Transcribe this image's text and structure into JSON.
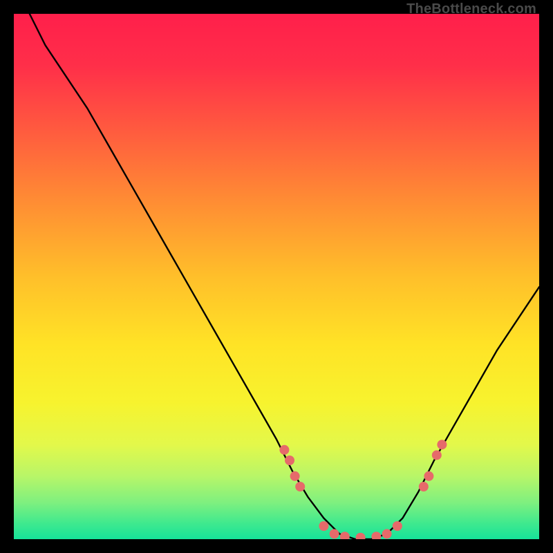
{
  "watermark": "TheBottleneck.com",
  "chart_data": {
    "type": "line",
    "title": "",
    "xlabel": "",
    "ylabel": "",
    "xlim": [
      0,
      100
    ],
    "ylim": [
      0,
      100
    ],
    "series": [
      {
        "name": "bottleneck-curve",
        "x": [
          3,
          6,
          10,
          14,
          18,
          22,
          26,
          30,
          34,
          38,
          42,
          46,
          50,
          53,
          56,
          59,
          62,
          65,
          68,
          71,
          74,
          77,
          80,
          84,
          88,
          92,
          96,
          100
        ],
        "y": [
          100,
          94,
          88,
          82,
          75,
          68,
          61,
          54,
          47,
          40,
          33,
          26,
          19,
          13,
          8,
          4,
          1,
          0,
          0,
          1,
          4,
          9,
          15,
          22,
          29,
          36,
          42,
          48
        ]
      }
    ],
    "scatter": {
      "name": "highlight-dots",
      "color": "#e66a6a",
      "points": [
        {
          "x": 51.5,
          "y": 17
        },
        {
          "x": 52.5,
          "y": 15
        },
        {
          "x": 53.5,
          "y": 12
        },
        {
          "x": 54.5,
          "y": 10
        },
        {
          "x": 59,
          "y": 2.5
        },
        {
          "x": 61,
          "y": 1
        },
        {
          "x": 63,
          "y": 0.5
        },
        {
          "x": 66,
          "y": 0.3
        },
        {
          "x": 69,
          "y": 0.5
        },
        {
          "x": 71,
          "y": 1
        },
        {
          "x": 73,
          "y": 2.5
        },
        {
          "x": 78,
          "y": 10
        },
        {
          "x": 79,
          "y": 12
        },
        {
          "x": 80.5,
          "y": 16
        },
        {
          "x": 81.5,
          "y": 18
        }
      ]
    },
    "gradient_stops": [
      {
        "offset": 0.0,
        "color": "#ff1f4b"
      },
      {
        "offset": 0.1,
        "color": "#ff2f49"
      },
      {
        "offset": 0.22,
        "color": "#ff5a3f"
      },
      {
        "offset": 0.35,
        "color": "#ff8a34"
      },
      {
        "offset": 0.5,
        "color": "#ffbf2a"
      },
      {
        "offset": 0.63,
        "color": "#ffe326"
      },
      {
        "offset": 0.74,
        "color": "#f7f32e"
      },
      {
        "offset": 0.82,
        "color": "#e3f84a"
      },
      {
        "offset": 0.88,
        "color": "#b8f668"
      },
      {
        "offset": 0.93,
        "color": "#7ff07f"
      },
      {
        "offset": 0.97,
        "color": "#3fe98e"
      },
      {
        "offset": 1.0,
        "color": "#16e39a"
      }
    ]
  }
}
